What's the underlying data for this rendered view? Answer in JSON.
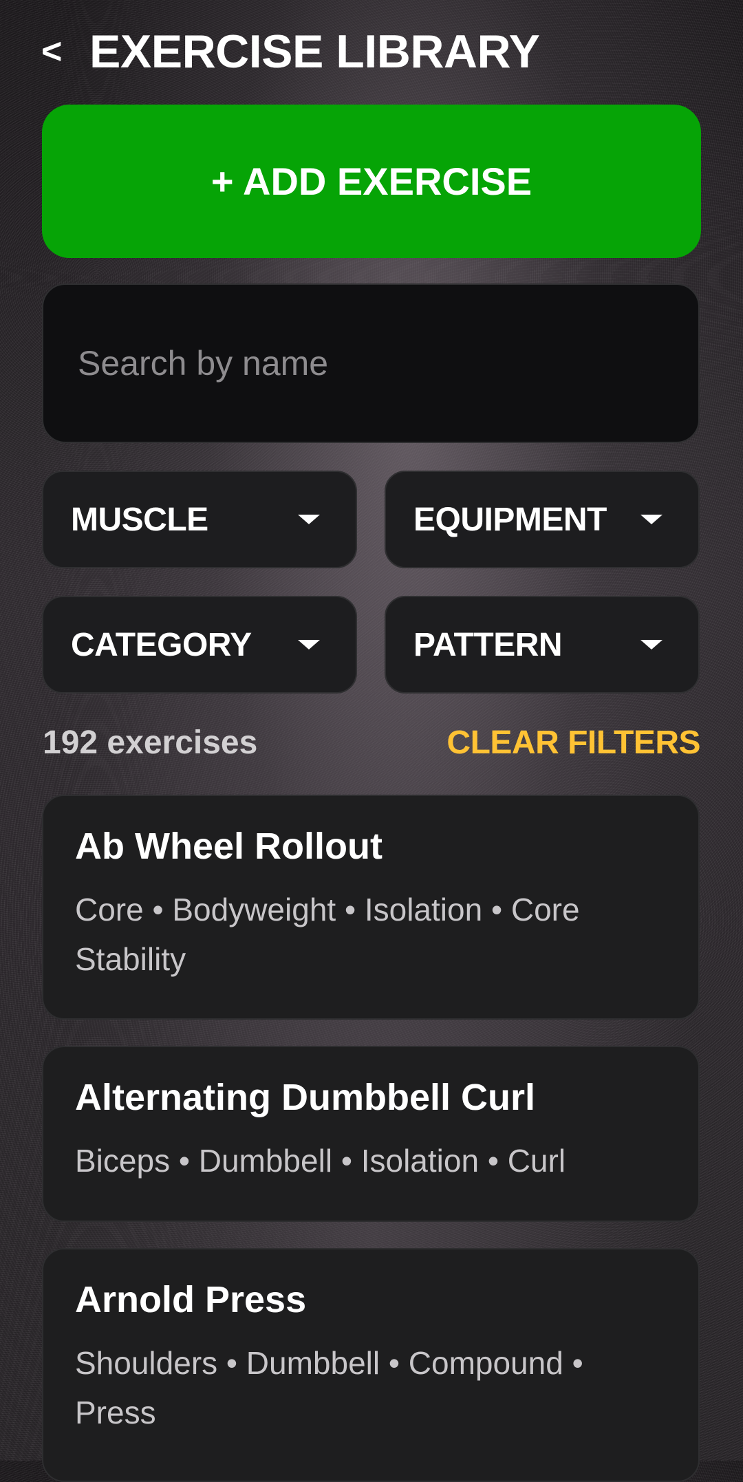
{
  "header": {
    "back_label": "<",
    "title": "EXERCISE LIBRARY"
  },
  "add_button": {
    "label": "+ ADD EXERCISE",
    "color": "#06a406"
  },
  "search": {
    "placeholder": "Search by name",
    "value": ""
  },
  "filters": [
    {
      "label": "MUSCLE",
      "icon": "chevron-down-icon"
    },
    {
      "label": "EQUIPMENT",
      "icon": "chevron-down-icon"
    },
    {
      "label": "CATEGORY",
      "icon": "chevron-down-icon"
    },
    {
      "label": "PATTERN",
      "icon": "chevron-down-icon"
    }
  ],
  "results": {
    "count_label": "192 exercises",
    "clear_label": "CLEAR FILTERS",
    "clear_color": "#ffc234"
  },
  "exercises": [
    {
      "name": "Ab Wheel Rollout",
      "meta": "Core • Bodyweight • Isolation • Core Stability"
    },
    {
      "name": "Alternating Dumbbell Curl",
      "meta": "Biceps • Dumbbell • Isolation • Curl"
    },
    {
      "name": "Arnold Press",
      "meta": "Shoulders • Dumbbell • Compound • Press"
    }
  ]
}
